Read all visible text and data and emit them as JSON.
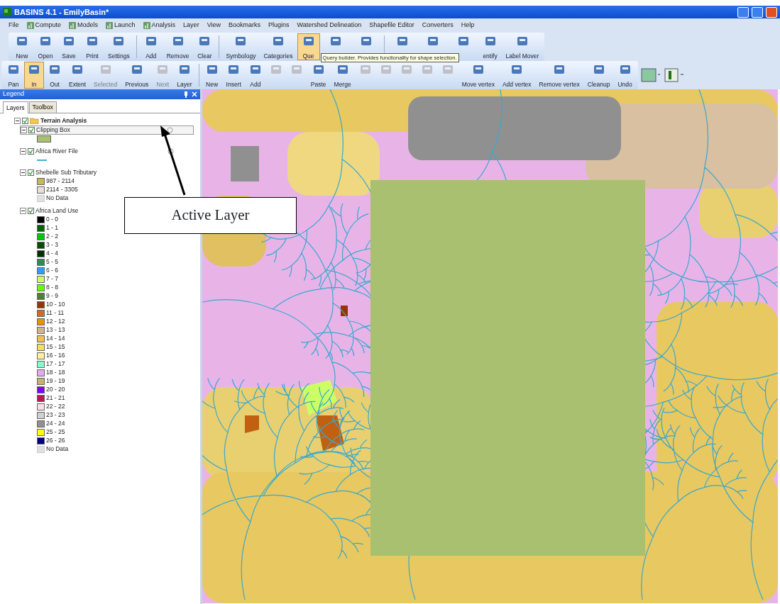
{
  "window": {
    "title": "BASINS 4.1  - EmilyBasin*"
  },
  "menu": [
    {
      "label": "File",
      "icon": false
    },
    {
      "label": "Compute",
      "icon": true
    },
    {
      "label": "Models",
      "icon": true
    },
    {
      "label": "Launch",
      "icon": true
    },
    {
      "label": "Analysis",
      "icon": true
    },
    {
      "label": "Layer",
      "icon": false
    },
    {
      "label": "View",
      "icon": false
    },
    {
      "label": "Bookmarks",
      "icon": false
    },
    {
      "label": "Plugins",
      "icon": false
    },
    {
      "label": "Watershed Delineation",
      "icon": false
    },
    {
      "label": "Shapefile Editor",
      "icon": false
    },
    {
      "label": "Converters",
      "icon": false
    },
    {
      "label": "Help",
      "icon": false
    }
  ],
  "toolbar_1": [
    {
      "buttons": [
        {
          "label": "New",
          "disabled": false,
          "selected": false
        },
        {
          "label": "Open",
          "disabled": false,
          "selected": false
        },
        {
          "label": "Save",
          "disabled": false,
          "selected": false
        },
        {
          "label": "Print",
          "disabled": false,
          "selected": false
        },
        {
          "label": "Settings",
          "disabled": false,
          "selected": false
        }
      ]
    },
    {
      "buttons": [
        {
          "label": "Add",
          "disabled": false,
          "selected": false
        },
        {
          "label": "Remove",
          "disabled": false,
          "selected": false
        },
        {
          "label": "Clear",
          "disabled": false,
          "selected": false
        }
      ]
    },
    {
      "buttons": [
        {
          "label": "Symbology",
          "disabled": false,
          "selected": false
        },
        {
          "label": "Categories",
          "disabled": false,
          "selected": false
        },
        {
          "label": "Que",
          "disabled": false,
          "selected": true
        },
        {
          "disabled": false,
          "selected": false
        },
        {
          "disabled": false,
          "selected": false
        }
      ]
    },
    {
      "buttons": [
        {
          "disabled": false,
          "selected": false
        },
        {
          "disabled": false,
          "selected": false
        },
        {
          "disabled": false,
          "selected": false
        },
        {
          "label": "entify",
          "disabled": false,
          "selected": false
        },
        {
          "label": "Label Mover",
          "disabled": false,
          "selected": false
        }
      ]
    }
  ],
  "tooltip": "Query builder. Provides functionality for shape selection.",
  "toolbar_2": [
    {
      "buttons": [
        {
          "label": "Pan",
          "disabled": false,
          "selected": false
        },
        {
          "label": "In",
          "disabled": false,
          "selected": true
        },
        {
          "label": "Out",
          "disabled": false,
          "selected": false
        },
        {
          "label": "Extent",
          "disabled": false,
          "selected": false
        },
        {
          "label": "Selected",
          "disabled": true,
          "selected": false
        },
        {
          "label": "Previous",
          "disabled": false,
          "selected": false
        },
        {
          "label": "Next",
          "disabled": true,
          "selected": false
        },
        {
          "label": "Layer",
          "disabled": false,
          "selected": false
        }
      ]
    },
    {
      "buttons": [
        {
          "label": "New",
          "disabled": false,
          "selected": false
        },
        {
          "label": "Insert",
          "disabled": false,
          "selected": false
        },
        {
          "label": "Add",
          "disabled": false,
          "selected": false
        },
        {
          "disabled": true,
          "selected": false
        },
        {
          "disabled": true,
          "selected": false
        },
        {
          "label": "Paste",
          "disabled": false,
          "selected": false
        },
        {
          "label": "Merge",
          "disabled": false,
          "selected": false
        },
        {
          "disabled": true,
          "selected": false
        },
        {
          "disabled": true,
          "selected": false
        },
        {
          "disabled": true,
          "selected": false
        },
        {
          "disabled": true,
          "selected": false
        },
        {
          "disabled": true,
          "selected": false
        },
        {
          "label": "Move vertex",
          "disabled": false,
          "selected": false
        },
        {
          "label": "Add vertex",
          "disabled": false,
          "selected": false
        },
        {
          "label": "Remove vertex",
          "disabled": false,
          "selected": false
        },
        {
          "label": "Cleanup",
          "disabled": false,
          "selected": false
        },
        {
          "label": "Undo",
          "disabled": false,
          "selected": false
        }
      ]
    }
  ],
  "legend": {
    "title": "Legend",
    "tabs": [
      {
        "label": "Layers",
        "selected": true
      },
      {
        "label": "Toolbox",
        "selected": false
      }
    ],
    "layers": [
      {
        "label": "Terrain Analysis",
        "kind": "group",
        "checked": true,
        "expanded": true,
        "selected": false,
        "children": [
          {
            "label": "Clipping Box",
            "kind": "layer",
            "checked": true,
            "expanded": true,
            "selected": true,
            "symbols": [
              {
                "kind": "fill",
                "color": "#a8c070"
              }
            ]
          },
          {
            "label": "Africa River File",
            "kind": "layer",
            "checked": true,
            "expanded": true,
            "selected": false,
            "symbols": [
              {
                "kind": "line",
                "color": "#40b0d0"
              }
            ]
          },
          {
            "label": "Shebelle Sub Tributary",
            "kind": "layer",
            "checked": true,
            "expanded": true,
            "selected": false,
            "symbols": [
              {
                "kind": "fill",
                "label": "987 - 2114",
                "color": "#c8b850"
              },
              {
                "kind": "fill",
                "label": "2114 - 3305",
                "color": "#e8e0d8"
              },
              {
                "kind": "nodata",
                "label": "No Data",
                "color": "#e0e0e0"
              }
            ]
          },
          {
            "label": "Africa Land Use",
            "kind": "layer",
            "checked": true,
            "expanded": true,
            "selected": false,
            "symbols": [
              {
                "kind": "fill",
                "label": "0 - 0",
                "color": "#000000"
              },
              {
                "kind": "fill",
                "label": "1 - 1",
                "color": "#006400"
              },
              {
                "kind": "fill",
                "label": "2 - 2",
                "color": "#00c800"
              },
              {
                "kind": "fill",
                "label": "3 - 3",
                "color": "#005000"
              },
              {
                "kind": "fill",
                "label": "4 - 4",
                "color": "#003000"
              },
              {
                "kind": "fill",
                "label": "5 - 5",
                "color": "#2e8b57"
              },
              {
                "kind": "fill",
                "label": "6 - 6",
                "color": "#3399ff"
              },
              {
                "kind": "fill",
                "label": "7 - 7",
                "color": "#ccff66"
              },
              {
                "kind": "fill",
                "label": "8 - 8",
                "color": "#66ff00"
              },
              {
                "kind": "fill",
                "label": "9 - 9",
                "color": "#4f7f2f"
              },
              {
                "kind": "fill",
                "label": "10 - 10",
                "color": "#993300"
              },
              {
                "kind": "fill",
                "label": "11 - 11",
                "color": "#d2691e"
              },
              {
                "kind": "fill",
                "label": "12 - 12",
                "color": "#e69500"
              },
              {
                "kind": "fill",
                "label": "13 - 13",
                "color": "#d2b48c"
              },
              {
                "kind": "fill",
                "label": "14 - 14",
                "color": "#f0c050"
              },
              {
                "kind": "fill",
                "label": "15 - 15",
                "color": "#f0e060"
              },
              {
                "kind": "fill",
                "label": "16 - 16",
                "color": "#fff0a0"
              },
              {
                "kind": "fill",
                "label": "17 - 17",
                "color": "#80ffd0"
              },
              {
                "kind": "fill",
                "label": "18 - 18",
                "color": "#e8a8f0"
              },
              {
                "kind": "fill",
                "label": "19 - 19",
                "color": "#c8b070"
              },
              {
                "kind": "fill",
                "label": "20 - 20",
                "color": "#8000ff"
              },
              {
                "kind": "fill",
                "label": "21 - 21",
                "color": "#c0145a"
              },
              {
                "kind": "fill",
                "label": "22 - 22",
                "color": "#f8e0e8"
              },
              {
                "kind": "fill",
                "label": "23 - 23",
                "color": "#d0d0d0"
              },
              {
                "kind": "fill",
                "label": "24 - 24",
                "color": "#909090"
              },
              {
                "kind": "fill",
                "label": "25 - 25",
                "color": "#ffff00"
              },
              {
                "kind": "fill",
                "label": "26 - 26",
                "color": "#000080"
              },
              {
                "kind": "nodata",
                "label": "No Data",
                "color": "#e0e0e0"
              }
            ]
          }
        ]
      }
    ]
  },
  "callout": {
    "label": "Active Layer"
  }
}
